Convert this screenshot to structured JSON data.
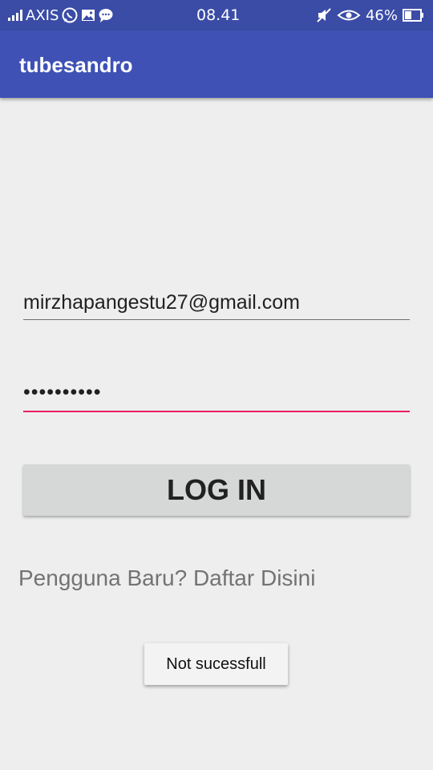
{
  "status_bar": {
    "carrier": "AXIS",
    "time": "08.41",
    "battery_percent": "46%",
    "icons": [
      "signal-icon",
      "whatsapp-icon",
      "image-icon",
      "message-icon",
      "mute-icon",
      "eye-icon",
      "battery-icon"
    ]
  },
  "app_bar": {
    "title": "tubesandro"
  },
  "form": {
    "email_value": "mirzhapangestu27@gmail.com",
    "password_value": "••••••••••",
    "login_label": "LOG IN",
    "register_link": "Pengguna Baru? Daftar Disini"
  },
  "toast": {
    "message": "Not sucessfull"
  },
  "colors": {
    "status_bar": "#3a4ca6",
    "app_bar": "#3f51b5",
    "accent": "#e91e63",
    "background": "#eeeeee",
    "button": "#d6d7d7"
  }
}
